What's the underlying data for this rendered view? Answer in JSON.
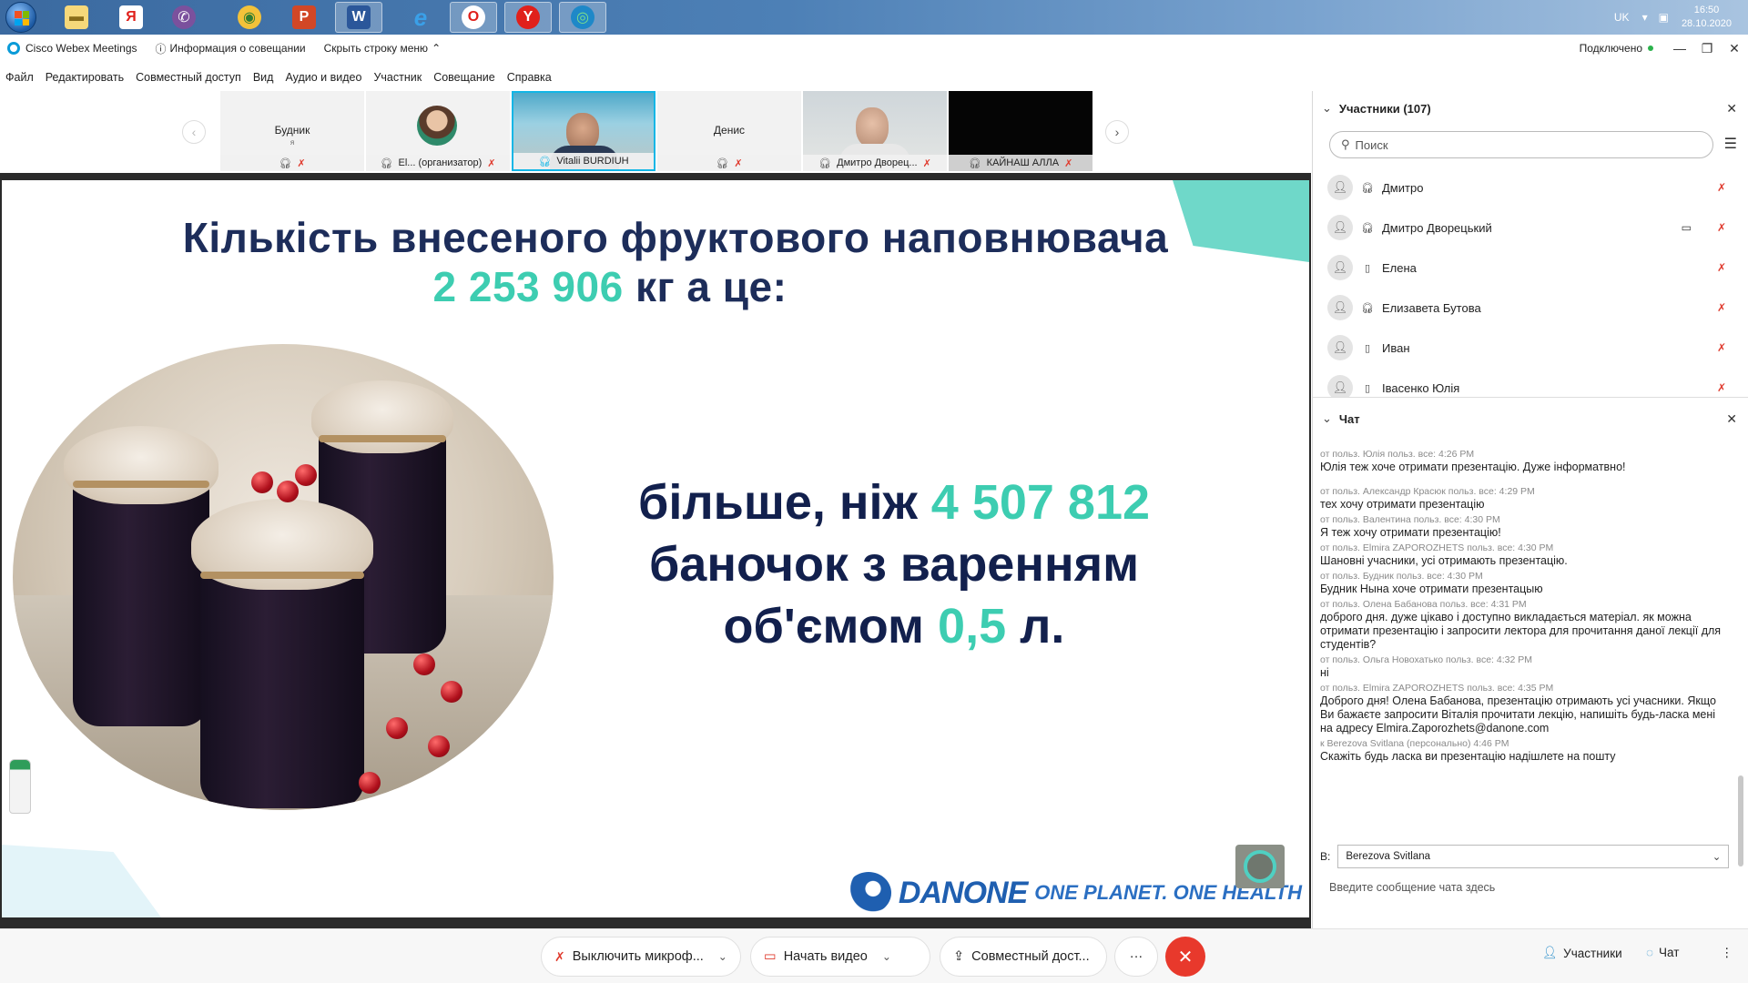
{
  "taskbar": {
    "language": "UK",
    "time": "16:50",
    "date": "28.10.2020",
    "apps": [
      {
        "name": "explorer",
        "glyph": "▬"
      },
      {
        "name": "yandex",
        "glyph": "Я"
      },
      {
        "name": "viber",
        "glyph": "✆"
      },
      {
        "name": "chrome",
        "glyph": "◉"
      },
      {
        "name": "powerpoint",
        "glyph": "P"
      },
      {
        "name": "word",
        "glyph": "W"
      },
      {
        "name": "ie",
        "glyph": "e"
      },
      {
        "name": "opera",
        "glyph": "O"
      },
      {
        "name": "yandex-browser",
        "glyph": "Y"
      },
      {
        "name": "webex",
        "glyph": "◎"
      }
    ]
  },
  "titlebar": {
    "app_name": "Cisco Webex Meetings",
    "meeting_info": "Информация о совещании",
    "hide_menu": "Скрыть строку меню",
    "status": "Подключено"
  },
  "menu": [
    "Файл",
    "Редактировать",
    "Совместный доступ",
    "Вид",
    "Аудио и видео",
    "Участник",
    "Совещание",
    "Справка"
  ],
  "video_strip": {
    "tiles": [
      {
        "name": "Будник",
        "sub": "я",
        "label": ""
      },
      {
        "name": "",
        "sub": "",
        "label": "El... (организатор)"
      },
      {
        "name": "",
        "sub": "",
        "label": "Vitalii BURDIUH"
      },
      {
        "name": "Денис",
        "sub": "",
        "label": ""
      },
      {
        "name": "",
        "sub": "",
        "label": "Дмитро Дворец..."
      },
      {
        "name": "",
        "sub": "",
        "label": "КАЙНАШ АЛЛА"
      }
    ]
  },
  "slide": {
    "title_line1": "Кількість внесеного фруктового наповнювача",
    "title_number": "2 253 906",
    "title_rest": "кг а це:",
    "body_line1_a": "більше, ніж",
    "body_line1_b": "4 507 812",
    "body_line2": "баночок з варенням",
    "body_line3_a": "об'ємом",
    "body_line3_b": "0,5",
    "body_line3_c": "л.",
    "brand": "DANONE",
    "brand_tag": "ONE PLANET. ONE HEALTH"
  },
  "participants": {
    "header": "Участники (107)",
    "search_placeholder": "Поиск",
    "list": [
      {
        "name": "Дмитро",
        "device": "headset",
        "video": false
      },
      {
        "name": "Дмитро Дворецький",
        "device": "headset",
        "video": true
      },
      {
        "name": "Елена",
        "device": "phone",
        "video": false
      },
      {
        "name": "Елизавета Бутова",
        "device": "headset",
        "video": false
      },
      {
        "name": "Иван",
        "device": "phone",
        "video": false
      },
      {
        "name": "Івасенко Юлія",
        "device": "phone",
        "video": false
      }
    ]
  },
  "chat": {
    "header": "Чат",
    "messages": [
      {
        "meta": "от польз. Юлія польз. все:   4:26 PM",
        "text": "Юлія теж хоче отримати презентацію. Дуже інформатвно!"
      },
      {
        "meta": "от польз. Александр Красюк польз. все:   4:29 PM",
        "text": "тех хочу отримати презентацію"
      },
      {
        "meta": "от польз. Валентина польз. все:   4:30 PM",
        "text": "Я теж хочу отримати презентацію!"
      },
      {
        "meta": "от польз. Elmira ZAPOROZHETS польз. все:   4:30 PM",
        "text": "Шановні учасники, усі отримають презентацію."
      },
      {
        "meta": "от польз. Будник польз. все:   4:30 PM",
        "text": "Будник Нына хоче отримати презентацыю"
      },
      {
        "meta": "от польз. Олена Бабанова польз. все:   4:31 PM",
        "text": "доброго дня. дуже цікаво і доступно викладається матеріал. як можна отримати презентацію і запросити лектора   для прочитання даної лекції для студентів?"
      },
      {
        "meta": "от польз. Ольга Новохатько польз. все:   4:32 PM",
        "text": "ні"
      },
      {
        "meta": "от польз. Elmira ZAPOROZHETS польз. все:   4:35 PM",
        "text": "Доброго дня! Олена Бабанова, презентацію отримають усі учасники. Якщо Ви бажаєте запросити Віталія прочитати лекцію, напишіть будь-ласка мені на адресу Elmira.Zaporozhets@danone.com"
      },
      {
        "meta": "к Berezova Svitlana (персонально)   4:46 PM",
        "text": "Скажіть будь ласка ви презентацію надішлете на пошту"
      }
    ],
    "to_label": "В:",
    "to_value": "Berezova Svitlana",
    "input_placeholder": "Введите сообщение чата здесь"
  },
  "toolbar": {
    "mute": "Выключить микроф...",
    "video": "Начать видео",
    "share": "Совместный дост...",
    "more": "···",
    "participants": "Участники",
    "chat": "Чат"
  }
}
